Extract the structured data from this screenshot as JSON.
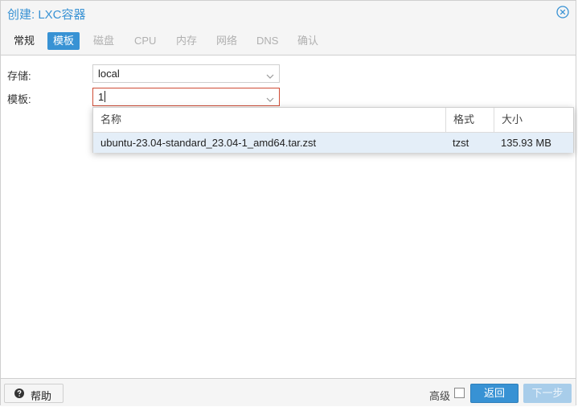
{
  "dialog": {
    "title": "创建: LXC容器"
  },
  "tabs": [
    {
      "label": "常规",
      "state": "enabled"
    },
    {
      "label": "模板",
      "state": "active"
    },
    {
      "label": "磁盘",
      "state": "disabled"
    },
    {
      "label": "CPU",
      "state": "disabled"
    },
    {
      "label": "内存",
      "state": "disabled"
    },
    {
      "label": "网络",
      "state": "disabled"
    },
    {
      "label": "DNS",
      "state": "disabled"
    },
    {
      "label": "确认",
      "state": "disabled"
    }
  ],
  "form": {
    "storage_label": "存储:",
    "storage_value": "local",
    "template_label": "模板:",
    "template_value": "1"
  },
  "template_dropdown": {
    "columns": [
      "名称",
      "格式",
      "大小"
    ],
    "rows": [
      [
        "ubuntu-23.04-standard_23.04-1_amd64.tar.zst",
        "tzst",
        "135.93 MB"
      ]
    ]
  },
  "footer": {
    "help_label": "帮助",
    "advanced_label": "高级",
    "back_label": "返回",
    "next_label": "下一步"
  },
  "colors": {
    "accent": "#3892d4",
    "invalid_border": "#cf4c35",
    "selected_row": "#e4eef8"
  }
}
